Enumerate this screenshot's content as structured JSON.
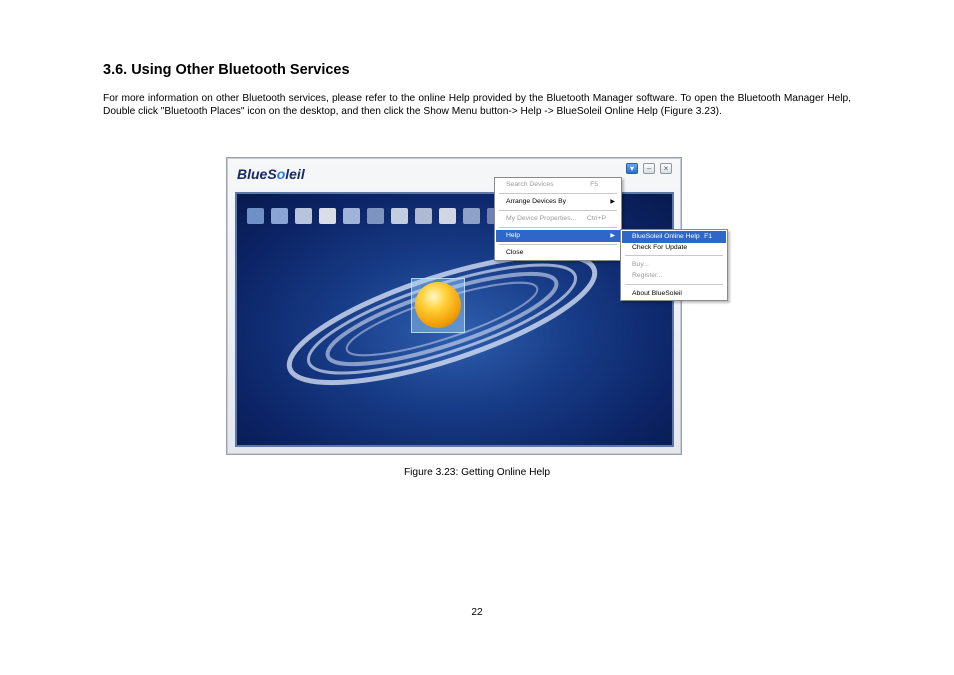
{
  "heading": "3.6. Using Other Bluetooth Services",
  "paragraph": "For more information on other Bluetooth services, please refer to the online Help provided by the Bluetooth Manager software. To open the Bluetooth Manager Help, Double click \"Bluetooth Places\" icon on the desktop, and then click the Show Menu button-> Help -> BlueSoleil Online Help (Figure 3.23).",
  "figure": {
    "caption": "Figure 3.23: Getting Online Help",
    "window": {
      "logo_pre": "BlueS",
      "logo_dot": "o",
      "logo_post": "leil",
      "controls": [
        "show-menu",
        "minimize",
        "close"
      ]
    },
    "main_menu": {
      "items": [
        {
          "label": "Search Devices",
          "shortcut": "F5",
          "disabled": true
        },
        {
          "label": "Arrange Devices By",
          "submenu": true,
          "disabled": false
        },
        {
          "label": "My Device Properties...",
          "shortcut": "Ctrl+P",
          "disabled": true
        },
        {
          "label": "Help",
          "submenu": true,
          "selected": true
        },
        {
          "label": "Close",
          "disabled": false
        }
      ]
    },
    "help_menu": {
      "items": [
        {
          "label": "BlueSoleil Online Help",
          "shortcut": "F1",
          "selected": true
        },
        {
          "label": "Check For Update",
          "disabled": false
        },
        {
          "label": "Buy...",
          "disabled": true
        },
        {
          "label": "Register...",
          "disabled": true
        },
        {
          "label": "About BlueSoleil",
          "disabled": false
        }
      ]
    },
    "colors": {
      "menu_highlight": "#2f67c9",
      "stage_bg": "#173b86"
    }
  },
  "page_number": "22"
}
